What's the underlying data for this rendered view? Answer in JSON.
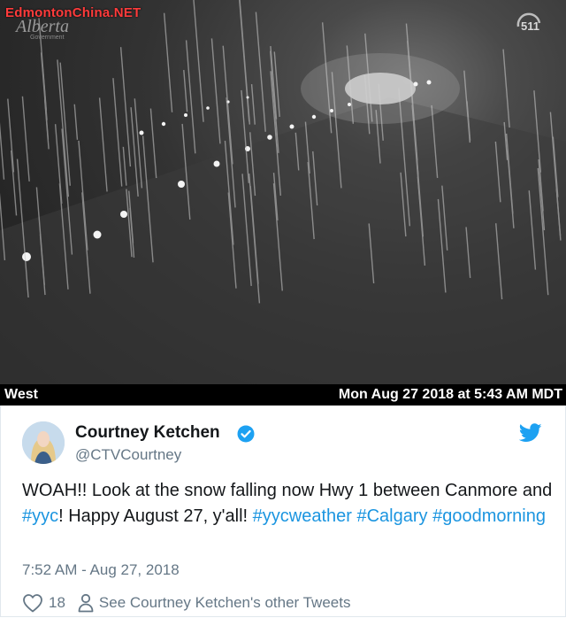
{
  "image": {
    "watermark": "EdmontonChina.NET",
    "brand": "Alberta",
    "brand_sub": "Government",
    "cam_logo": "511",
    "caption_left": "West",
    "caption_right": "Mon Aug 27 2018 at 5:43 AM MDT"
  },
  "tweet": {
    "name": "Courtney Ketchen",
    "handle": "@CTVCourtney",
    "text_parts": [
      {
        "t": "WOAH!! Look at the snow falling now Hwy 1 between Canmore and ",
        "tag": false
      },
      {
        "t": "#yyc",
        "tag": true
      },
      {
        "t": "! Happy August 27, y'all! ",
        "tag": false
      },
      {
        "t": "#yycweather",
        "tag": true
      },
      {
        "t": " ",
        "tag": false
      },
      {
        "t": "#Calgary",
        "tag": true
      },
      {
        "t": " ",
        "tag": false
      },
      {
        "t": "#goodmorning",
        "tag": true
      }
    ],
    "timestamp": "7:52 AM - Aug 27, 2018",
    "likes": "18",
    "other_tweets": "See Courtney Ketchen's other Tweets"
  },
  "icons": {
    "like": "heart-icon",
    "profile": "person-icon",
    "verified": "verified-badge-icon",
    "brand": "twitter-bird-icon"
  },
  "colors": {
    "link": "#1b95e0",
    "verified": "#1da1f2",
    "twitter": "#1da1f2",
    "watermark": "#ff3b3b",
    "muted": "#657786"
  }
}
